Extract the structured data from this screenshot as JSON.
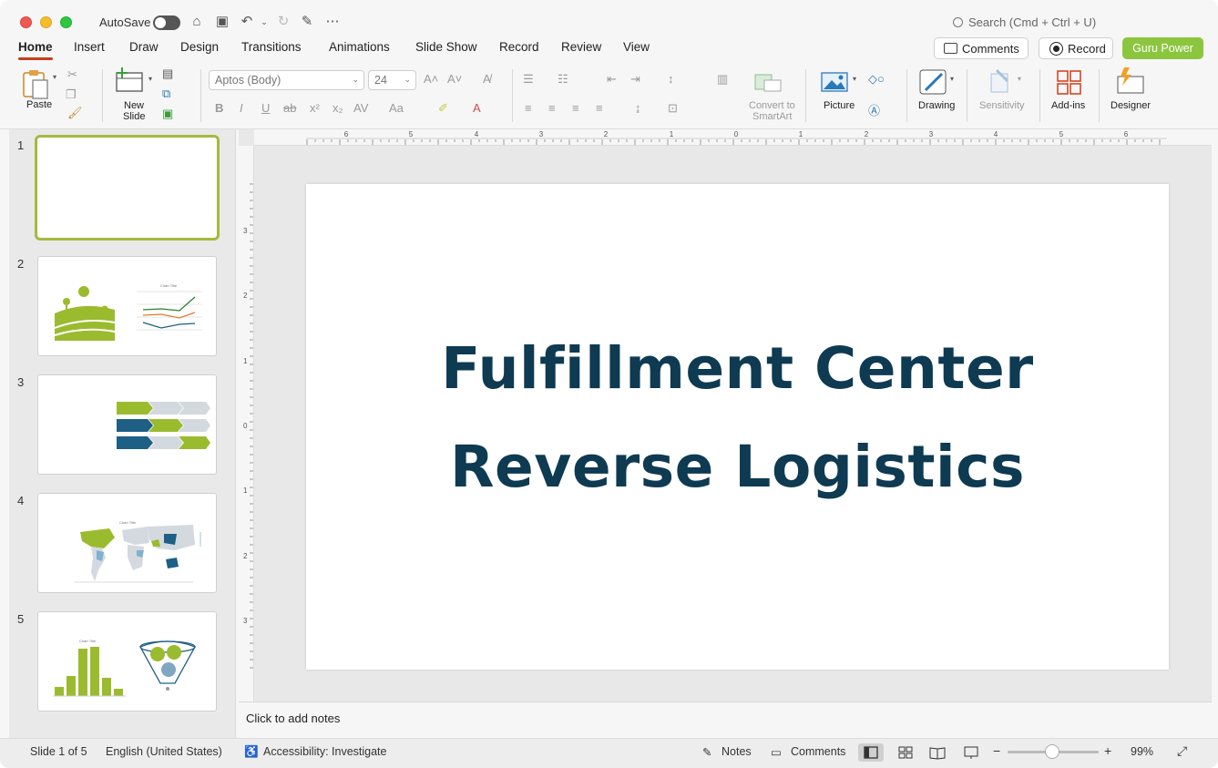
{
  "titlebar": {
    "autosave_label": "AutoSave",
    "search_placeholder": "Search (Cmd + Ctrl + U)"
  },
  "tabs": [
    "Home",
    "Insert",
    "Draw",
    "Design",
    "Transitions",
    "Animations",
    "Slide Show",
    "Record",
    "Review",
    "View"
  ],
  "top_buttons": {
    "comments": "Comments",
    "record": "Record",
    "guru": "Guru Power"
  },
  "ribbon": {
    "paste": "Paste",
    "new_slide_1": "New",
    "new_slide_2": "Slide",
    "font_name": "Aptos (Body)",
    "font_size": "24",
    "convert_1": "Convert to",
    "convert_2": "SmartArt",
    "picture": "Picture",
    "drawing": "Drawing",
    "sensitivity": "Sensitivity",
    "addins": "Add-ins",
    "designer": "Designer"
  },
  "thumbnails": [
    {
      "num": "1"
    },
    {
      "num": "2",
      "chart_title": "Chart Title"
    },
    {
      "num": "3"
    },
    {
      "num": "4",
      "chart_title": "Chart Title"
    },
    {
      "num": "5",
      "chart_title": "Chart Title"
    }
  ],
  "ruler_top": [
    "6",
    "5",
    "4",
    "3",
    "2",
    "1",
    "0",
    "1",
    "2",
    "3",
    "4",
    "5",
    "6"
  ],
  "ruler_left": [
    "3",
    "2",
    "1",
    "0",
    "1",
    "2",
    "3"
  ],
  "slide": {
    "title_line1": "Fulfillment Center",
    "title_line2": "Reverse Logistics"
  },
  "notes_placeholder": "Click to add notes",
  "status": {
    "slide_indicator": "Slide 1 of 5",
    "language": "English (United States)",
    "accessibility": "Accessibility: Investigate",
    "notes": "Notes",
    "comments": "Comments",
    "zoom": "99%"
  },
  "colors": {
    "accent_red": "#c43e1c",
    "guru_green": "#8cc63f",
    "title_navy": "#0e3a52",
    "thumb_green": "#9bbb2f",
    "thumb_blue": "#1d5f85",
    "thumb_gray": "#d3d9de"
  }
}
